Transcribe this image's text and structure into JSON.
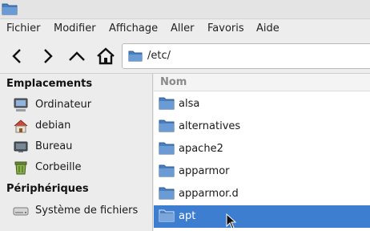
{
  "menubar": {
    "items": [
      "Fichier",
      "Modifier",
      "Affichage",
      "Aller",
      "Favoris",
      "Aide"
    ]
  },
  "toolbar": {
    "back_icon": "chevron-left-icon",
    "forward_icon": "chevron-right-icon",
    "up_icon": "chevron-up-icon",
    "home_icon": "home-icon"
  },
  "location": {
    "path": "/etc/"
  },
  "sidebar": {
    "sections": [
      {
        "title": "Emplacements",
        "items": [
          {
            "label": "Ordinateur",
            "icon": "computer-icon"
          },
          {
            "label": "debian",
            "icon": "home-folder-icon"
          },
          {
            "label": "Bureau",
            "icon": "desktop-icon"
          },
          {
            "label": "Corbeille",
            "icon": "trash-icon"
          }
        ]
      },
      {
        "title": "Périphériques",
        "items": [
          {
            "label": "Système de fichiers",
            "icon": "drive-icon"
          }
        ]
      }
    ]
  },
  "main": {
    "column_header": "Nom",
    "rows": [
      {
        "label": "alsa",
        "selected": false
      },
      {
        "label": "alternatives",
        "selected": false
      },
      {
        "label": "apache2",
        "selected": false
      },
      {
        "label": "apparmor",
        "selected": false
      },
      {
        "label": "apparmor.d",
        "selected": false
      },
      {
        "label": "apt",
        "selected": true
      }
    ]
  },
  "colors": {
    "selection": "#3d7ed0",
    "folder": "#5b8fc9",
    "window_bg": "#ececec"
  }
}
